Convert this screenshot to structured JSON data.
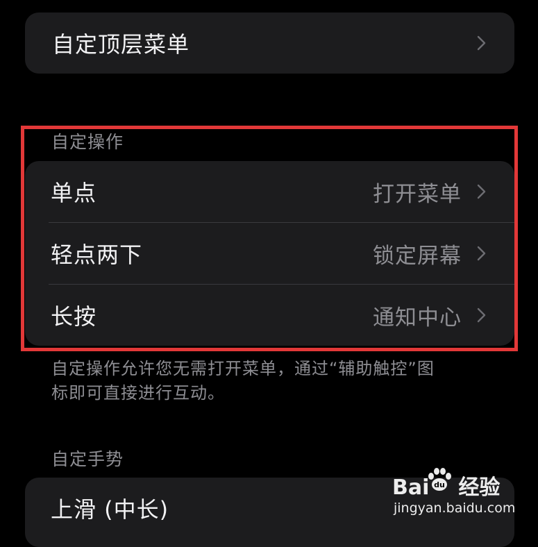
{
  "top_menu": {
    "label": "自定顶层菜单"
  },
  "custom_actions": {
    "header": "自定操作",
    "rows": [
      {
        "label": "单点",
        "value": "打开菜单"
      },
      {
        "label": "轻点两下",
        "value": "锁定屏幕"
      },
      {
        "label": "长按",
        "value": "通知中心"
      }
    ],
    "footer_line1": "自定操作允许您无需打开菜单，通过“辅助触控”图",
    "footer_line2": "标即可直接进行互动。"
  },
  "custom_gestures": {
    "header": "自定手势",
    "rows": [
      {
        "label": "上滑 (中长)"
      }
    ]
  },
  "watermark": {
    "brand_left": "Bai",
    "brand_right": "经验",
    "site": "jingyan.baidu.com"
  },
  "colors": {
    "background": "#000000",
    "cell": "#1c1c1e",
    "secondary_text": "#8e8e93",
    "highlight": "#e23838"
  }
}
